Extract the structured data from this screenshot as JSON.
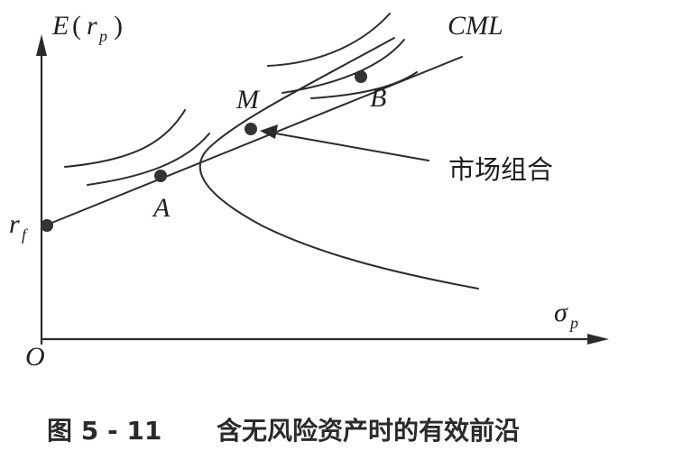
{
  "axes": {
    "y_label_main": "E",
    "y_label_open": "(",
    "y_label_var": "r",
    "y_label_sub": "p",
    "y_label_close": ")",
    "x_label_main": "σ",
    "x_label_sub": "p",
    "origin_label": "O"
  },
  "lines": {
    "cml_label": "CML"
  },
  "points": {
    "rf_main": "r",
    "rf_sub": "f",
    "a_label": "A",
    "m_label": "M",
    "b_label": "B"
  },
  "annotations": {
    "market_portfolio": "市场组合"
  },
  "caption": {
    "number": "图 5 - 11",
    "title": "含无风险资产时的有效前沿"
  }
}
